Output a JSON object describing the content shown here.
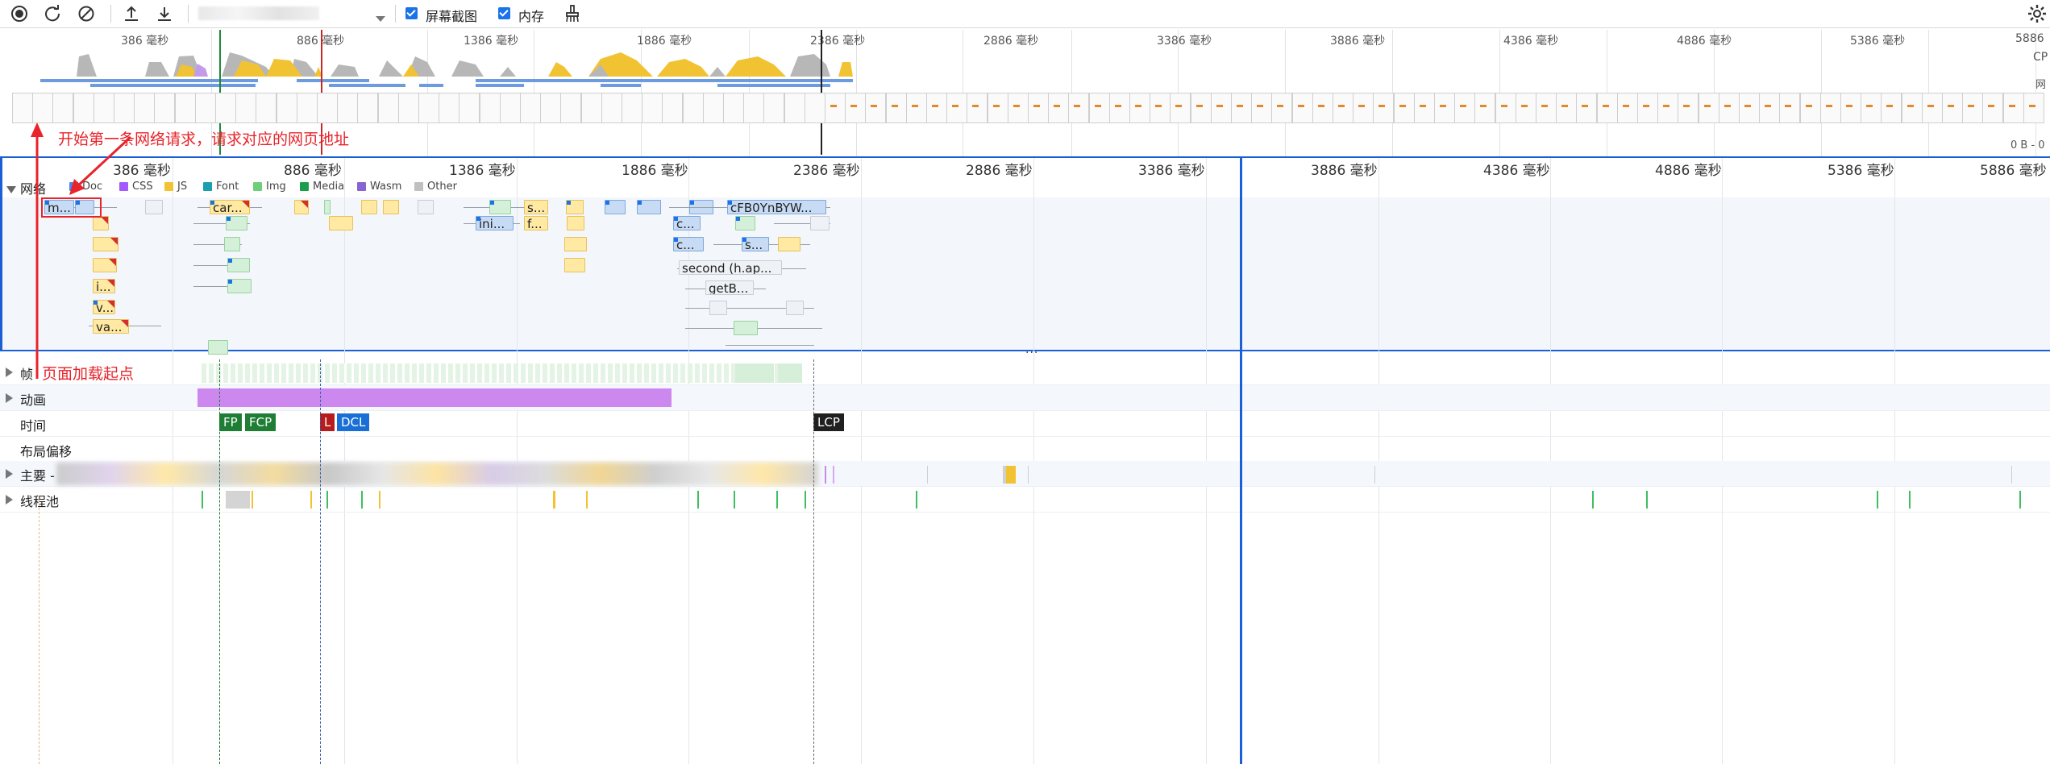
{
  "toolbar": {
    "screenshots_label": "屏幕截图",
    "memory_label": "内存",
    "screenshots_checked": true,
    "memory_checked": true,
    "icons": [
      "record-icon",
      "reload-record-icon",
      "clear-icon",
      "upload-icon",
      "download-icon",
      "dropdown-icon",
      "broom-icon",
      "gear-icon"
    ]
  },
  "overview": {
    "ticks": [
      "386 毫秒",
      "886 毫秒",
      "1386 毫秒",
      "1886 毫秒",
      "2386 毫秒",
      "2886 毫秒",
      "3386 毫秒",
      "3886 毫秒",
      "4386 毫秒",
      "4886 毫秒",
      "5386 毫秒",
      "5886"
    ],
    "side_labels": [
      "CP",
      "网",
      "0 B - 0"
    ]
  },
  "network": {
    "title": "网络",
    "ticks": [
      "386 毫秒",
      "886 毫秒",
      "1386 毫秒",
      "1886 毫秒",
      "2386 毫秒",
      "2886 毫秒",
      "3386 毫秒",
      "3886 毫秒",
      "4386 毫秒",
      "4886 毫秒",
      "5386 毫秒",
      "5886 毫秒"
    ],
    "legend": [
      {
        "label": "Doc",
        "color": "#4a86e8"
      },
      {
        "label": "CSS",
        "color": "#a259ff"
      },
      {
        "label": "JS",
        "color": "#f1c232"
      },
      {
        "label": "Font",
        "color": "#1a9fb0"
      },
      {
        "label": "Img",
        "color": "#6ecf7a"
      },
      {
        "label": "Media",
        "color": "#1a9e4a"
      },
      {
        "label": "Wasm",
        "color": "#8a63d2"
      },
      {
        "label": "Other",
        "color": "#c0c0c0"
      }
    ],
    "requests": [
      "m...",
      "car...",
      "s...",
      "f...",
      "ini...",
      "c...",
      "c...",
      "s...",
      "cFB0YnBYW...",
      "second (h.ap...",
      "getB...",
      "i...",
      "v...",
      "va..."
    ]
  },
  "tracks": {
    "frames": "帧",
    "animation": "动画",
    "timings": "时间",
    "layout_shift": "布局偏移",
    "main": "主要 -",
    "thread_pool": "线程池"
  },
  "markers": {
    "fp": "FP",
    "fcp": "FCP",
    "l": "L",
    "dcl": "DCL",
    "lcp": "LCP"
  },
  "annotations": {
    "first_request": "开始第一条网络请求，请求对应的网页地址",
    "load_start": "页面加载起点"
  }
}
